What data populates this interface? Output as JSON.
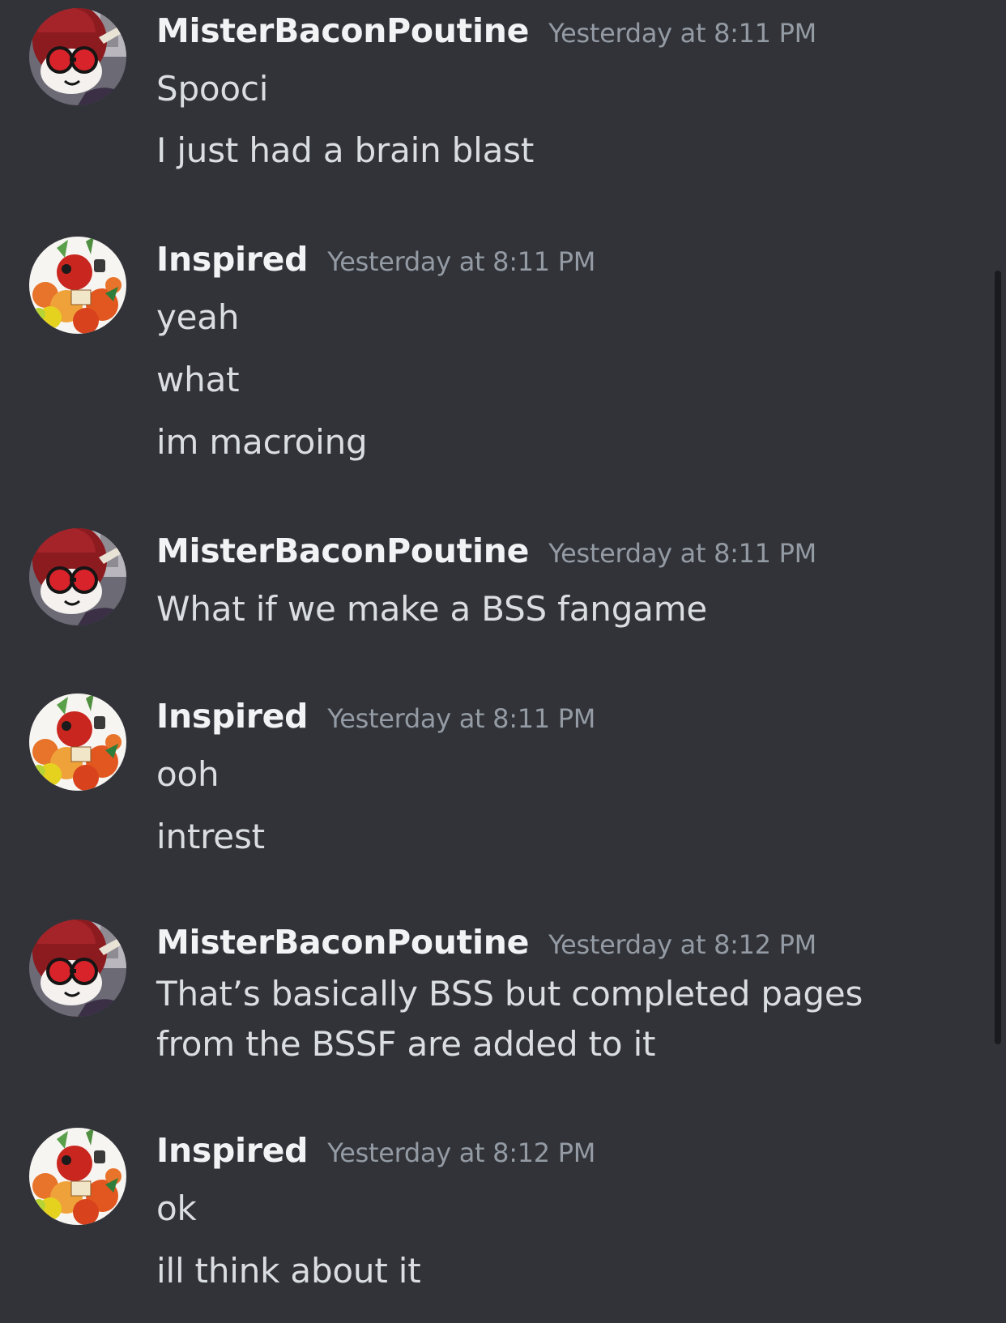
{
  "messages": [
    {
      "username": "MisterBaconPoutine",
      "timestamp": "Yesterday at 8:11 PM",
      "avatar": "red-character-avatar",
      "lines": [
        "Spooci",
        "I just had a brain blast"
      ]
    },
    {
      "username": "Inspired",
      "timestamp": "Yesterday at 8:11 PM",
      "avatar": "bee-collage-avatar",
      "lines": [
        "yeah",
        "what",
        "im macroing"
      ]
    },
    {
      "username": "MisterBaconPoutine",
      "timestamp": "Yesterday at 8:11 PM",
      "avatar": "red-character-avatar",
      "lines": [
        "What if we make a BSS fangame"
      ]
    },
    {
      "username": "Inspired",
      "timestamp": "Yesterday at 8:11 PM",
      "avatar": "bee-collage-avatar",
      "lines": [
        "ooh",
        "intrest"
      ]
    },
    {
      "username": "MisterBaconPoutine",
      "timestamp": "Yesterday at 8:12 PM",
      "avatar": "red-character-avatar",
      "lines": [
        "That’s basically BSS but completed pages from the BSSF are added to it"
      ]
    },
    {
      "username": "Inspired",
      "timestamp": "Yesterday at 8:12 PM",
      "avatar": "bee-collage-avatar",
      "lines": [
        "ok",
        "ill think about it"
      ]
    }
  ],
  "colors": {
    "background": "#313338",
    "username": "#f2f3f5",
    "timestamp": "#949ba4",
    "message_text": "#dbdee1",
    "scrollbar": "#1a1b1e"
  }
}
